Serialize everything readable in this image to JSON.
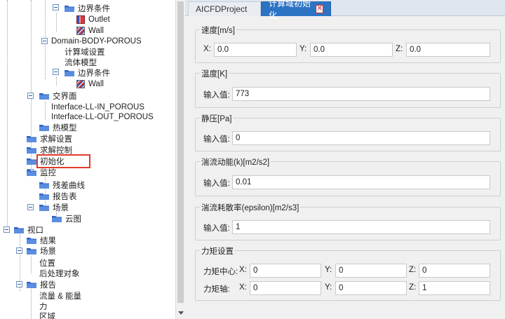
{
  "tree": {
    "items": [
      {
        "label": "边界条件",
        "kind": "folder"
      },
      {
        "label": "Outlet",
        "kind": "outlet"
      },
      {
        "label": "Wall",
        "kind": "wall"
      },
      {
        "label": "Domain-BODY-POROUS",
        "kind": "text"
      },
      {
        "label": "计算域设置",
        "kind": "text"
      },
      {
        "label": "流体模型",
        "kind": "text"
      },
      {
        "label": "边界条件",
        "kind": "folder"
      },
      {
        "label": "Wall",
        "kind": "wall"
      },
      {
        "label": "交界面",
        "kind": "folder"
      },
      {
        "label": "Interface-LL-IN_POROUS",
        "kind": "text"
      },
      {
        "label": "Interface-LL-OUT_POROUS",
        "kind": "text"
      },
      {
        "label": "热模型",
        "kind": "folder"
      },
      {
        "label": "求解设置",
        "kind": "folder"
      },
      {
        "label": "求解控制",
        "kind": "folder"
      },
      {
        "label": "初始化",
        "kind": "folder"
      },
      {
        "label": "监控",
        "kind": "folder"
      },
      {
        "label": "残差曲线",
        "kind": "folder"
      },
      {
        "label": "报告表",
        "kind": "folder"
      },
      {
        "label": "场景",
        "kind": "folder"
      },
      {
        "label": "云图",
        "kind": "folder"
      },
      {
        "label": "视口",
        "kind": "folder"
      },
      {
        "label": "结果",
        "kind": "folder"
      },
      {
        "label": "场景",
        "kind": "folder"
      },
      {
        "label": "位置",
        "kind": "text"
      },
      {
        "label": "后处理对象",
        "kind": "text"
      },
      {
        "label": "报告",
        "kind": "folder"
      },
      {
        "label": "流量 & 能量",
        "kind": "text"
      },
      {
        "label": "力",
        "kind": "text"
      },
      {
        "label": "区域",
        "kind": "text"
      }
    ]
  },
  "tabs": {
    "inactive": "AICFDProject",
    "active": "计算域初始化",
    "close": "✕"
  },
  "velocity": {
    "title": "速度[m/s]",
    "x_label": "X:",
    "x_value": "0.0",
    "y_label": "Y:",
    "y_value": "0.0",
    "z_label": "Z:",
    "z_value": "0.0"
  },
  "temperature": {
    "title": "温度[K]",
    "label": "输入值:",
    "value": "773"
  },
  "static_pressure": {
    "title": "静压[Pa]",
    "label": "输入值:",
    "value": "0"
  },
  "turb_k": {
    "title": "湍流动能(k)[m2/s2]",
    "label": "输入值:",
    "value": "0.01"
  },
  "turb_eps": {
    "title": "湍流耗散率(epsilon)[m2/s3]",
    "label": "输入值:",
    "value": "1"
  },
  "moment": {
    "title": "力矩设置",
    "center_label": "力矩中心:",
    "axis_label": "力矩轴:",
    "x_label": "X:",
    "y_label": "Y:",
    "z_label": "Z:",
    "center_x": "0",
    "center_y": "0",
    "center_z": "0",
    "axis_x": "0",
    "axis_y": "0",
    "axis_z": "1"
  },
  "colors": {
    "active_tab": "#2c73c4",
    "highlight_border": "#e23a2a",
    "tree_folder": "#2f63c6"
  }
}
